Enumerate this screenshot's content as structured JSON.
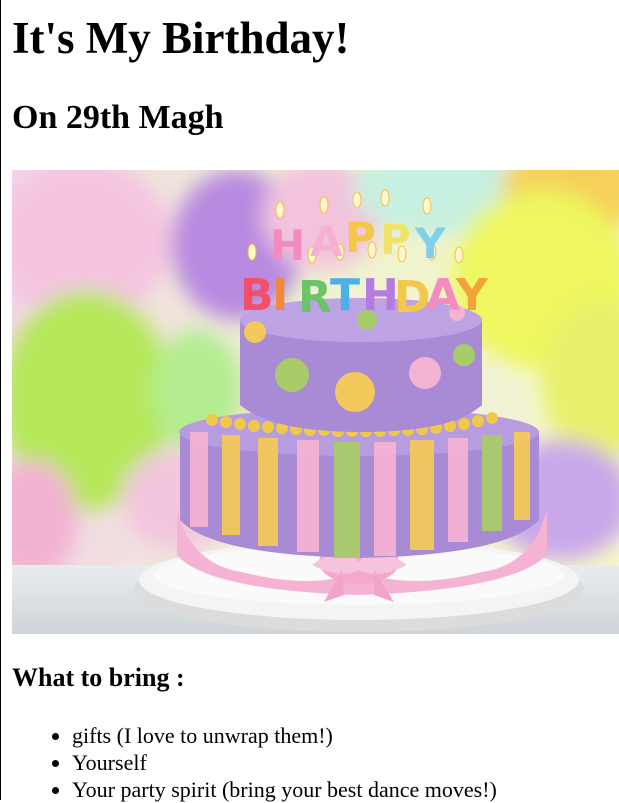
{
  "page": {
    "title": "It's My Birthday!",
    "subtitle": "On 29th Magh",
    "section_heading": "What to bring :",
    "bring_list": [
      "gifts (I love to unwrap them!)",
      "Yourself",
      "Your party spirit (bring your best dance moves!)"
    ]
  },
  "image": {
    "candle_letters_top": [
      "H",
      "A",
      "P",
      "P",
      "Y"
    ],
    "candle_letters_bottom": [
      "B",
      "I",
      "R",
      "T",
      "H",
      "D",
      "A",
      "Y"
    ],
    "colors": {
      "cake_purple": "#a98ad4",
      "ribbon_pink": "#f5b3d3",
      "ribbon_yellow": "#f2c95a",
      "ribbon_green": "#a9cc6b",
      "board_white": "#f4f4f4"
    }
  }
}
